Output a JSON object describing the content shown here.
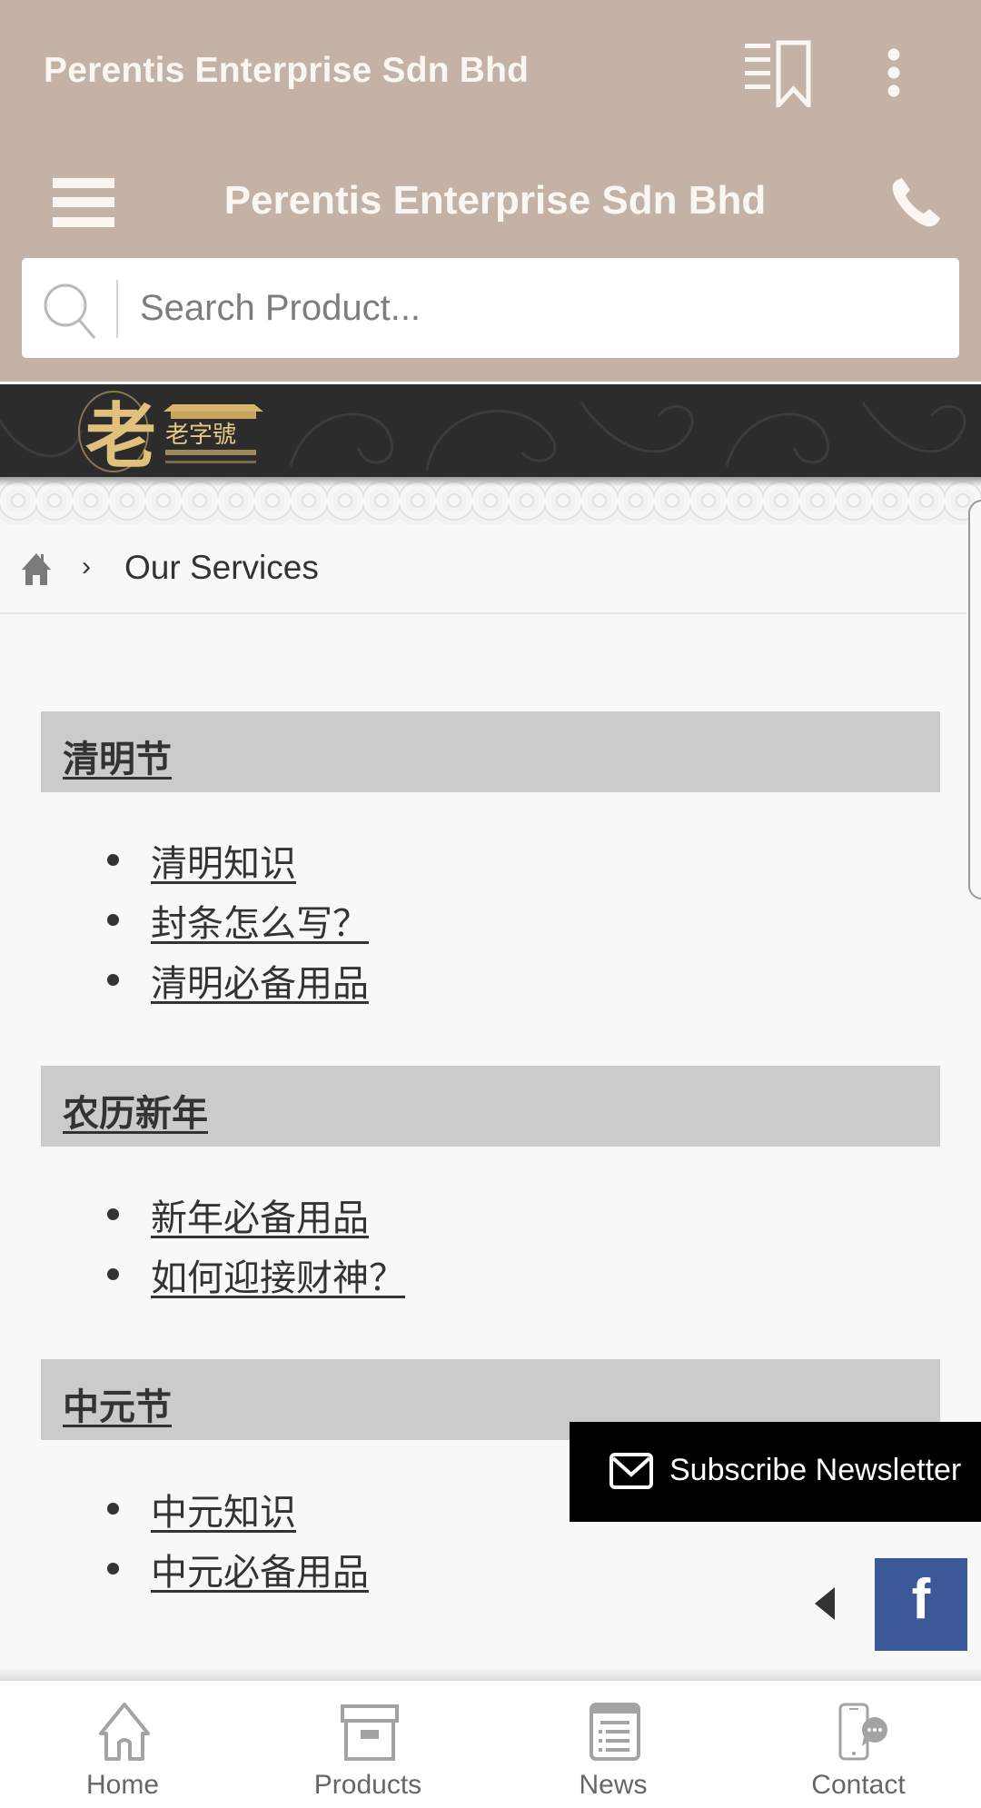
{
  "app_bar": {
    "title": "Perentis Enterprise Sdn Bhd",
    "icons": [
      "bookmark-list-icon",
      "more-vert-icon"
    ]
  },
  "site_header": {
    "title": "Perentis Enterprise Sdn Bhd",
    "icons": [
      "hamburger-menu-icon",
      "phone-icon"
    ]
  },
  "search": {
    "placeholder": "Search Product...",
    "value": ""
  },
  "banner": {
    "logo_text": "老字號",
    "logo_mark": "老"
  },
  "breadcrumb": {
    "home_icon": "home-icon",
    "separator": "›",
    "current": "Our Services"
  },
  "sections": [
    {
      "title": "清明节",
      "links": [
        "清明知识",
        "封条怎么写？",
        "清明必备用品"
      ]
    },
    {
      "title": "农历新年",
      "links": [
        "新年必备用品",
        "如何迎接财神？"
      ]
    },
    {
      "title": "中元节",
      "links": [
        "中元知识",
        "中元必备用品"
      ]
    }
  ],
  "subscribe": {
    "label": "Subscribe Newsletter",
    "icon": "mail-icon"
  },
  "social": {
    "facebook_label": "f",
    "facebook_color": "#3b5998"
  },
  "bottom_nav": [
    {
      "label": "Home",
      "icon": "home-icon"
    },
    {
      "label": "Products",
      "icon": "box-icon"
    },
    {
      "label": "News",
      "icon": "news-icon"
    },
    {
      "label": "Contact",
      "icon": "contact-phone-chat-icon"
    }
  ],
  "colors": {
    "header_bg": "#c4b2a6",
    "header_text": "#fbf6f1",
    "section_header_bg": "#cbcbcb",
    "banner_bg": "#2c2c2c",
    "logo_gold": "#d9b56a"
  }
}
